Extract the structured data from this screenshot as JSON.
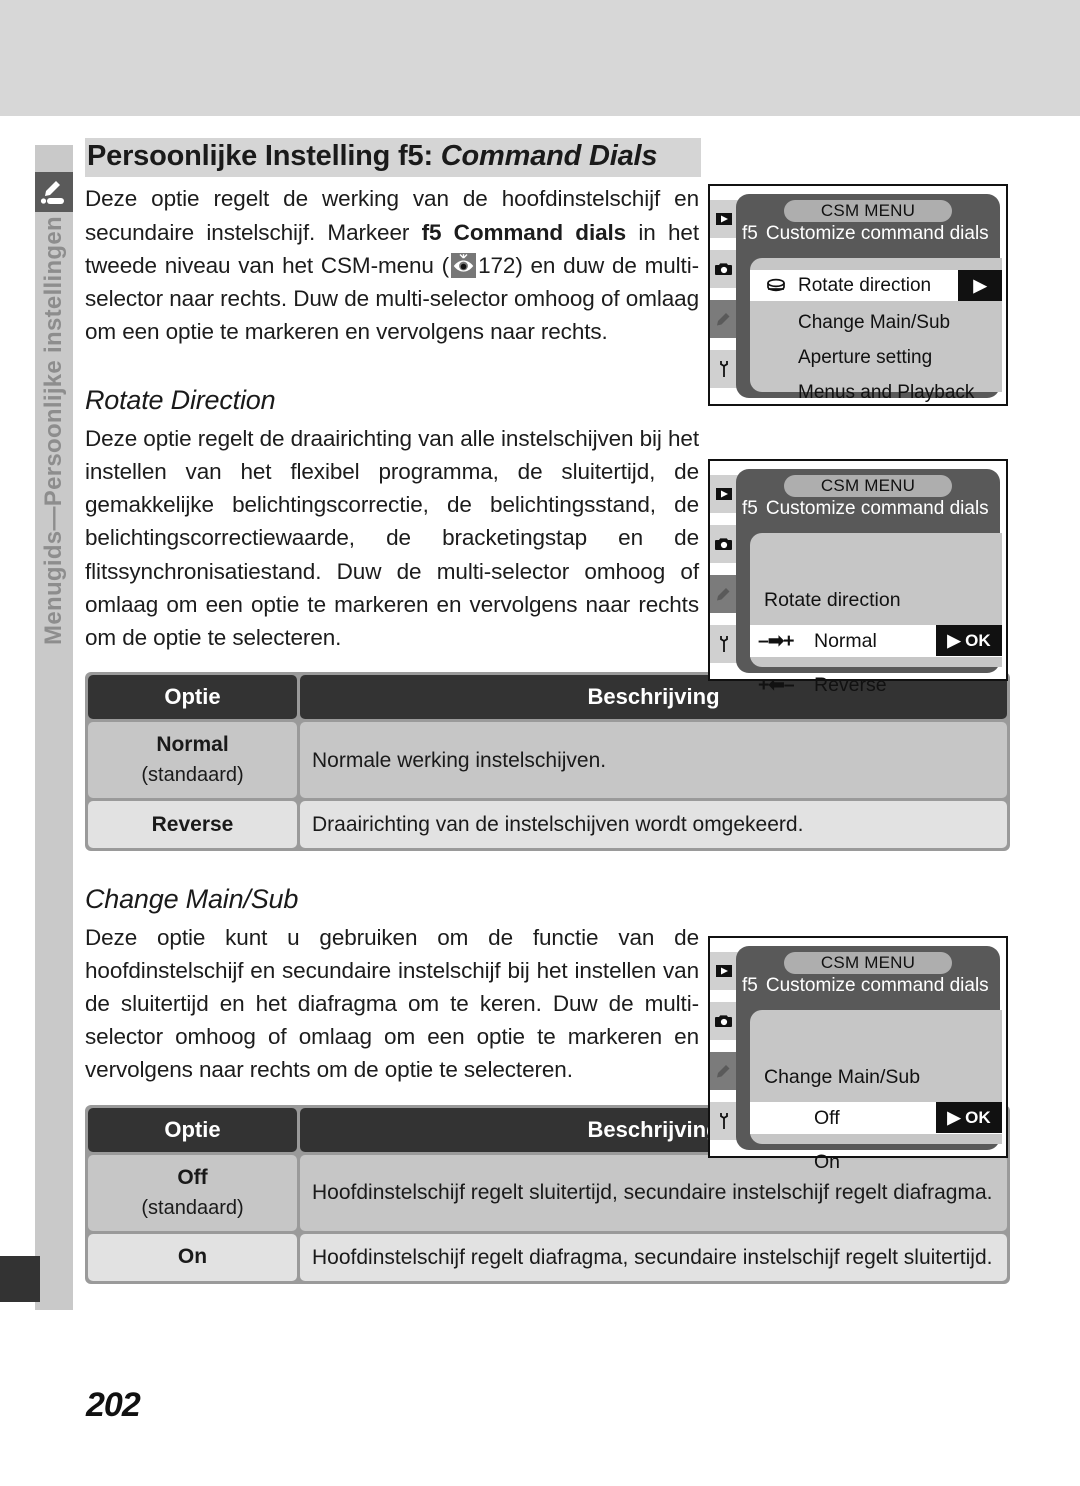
{
  "page": {
    "number": "202",
    "side_label": "Menugids—Persoonlijke instellingen",
    "side_icon": "pencil-bookmark-icon"
  },
  "heading": {
    "title_plain": "Persoonlijke Instelling f5: ",
    "title_italic": "Command Dials"
  },
  "intro": {
    "part1": "Deze optie regelt de werking van de hoofdinstelschijf en secundaire instelschijf. Markeer ",
    "bold": "f5 Command dials",
    "part2": " in het tweede niveau van het CSM-menu (",
    "page_ref": "172",
    "part3": ") en duw de multi-selector naar rechts. Duw de multi-selector omhoog of omlaag om een optie te markeren en vervolgens naar rechts."
  },
  "section_rotate": {
    "title": "Rotate Direction",
    "body": "Deze optie regelt de draairichting van alle instelschijven bij het instellen van het flexibel programma, de sluitertijd, de gemakkelijke belichtingscorrectie, de belichtingsstand, de belichtingscorrectiewaarde, de bracketingstap en de flitssynchronisatiestand. Duw de multi-selector omhoog of omlaag om een optie te markeren en vervolgens naar rechts om de optie te selecteren."
  },
  "section_change": {
    "title": "Change Main/Sub",
    "body": "Deze optie kunt u gebruiken om de functie van de hoofdinstelschijf en secundaire instelschijf bij het instellen van de sluitertijd en het diafragma om te keren. Duw de multi-selector omhoog of omlaag om een optie te markeren en vervolgens naar rechts om de optie te selecteren."
  },
  "table_rotate": {
    "headers": {
      "option": "Optie",
      "description": "Beschrijving"
    },
    "rows": [
      {
        "option": "Normal",
        "default_note": "(standaard)",
        "description": "Normale werking instelschijven."
      },
      {
        "option": "Reverse",
        "default_note": "",
        "description": "Draairichting van de instelschijven wordt omgekeerd."
      }
    ]
  },
  "table_change": {
    "headers": {
      "option": "Optie",
      "description": "Beschrijving"
    },
    "rows": [
      {
        "option": "Off",
        "default_note": "(standaard)",
        "description": "Hoofdinstelschijf regelt sluitertijd, secundaire instelschijf regelt diafragma."
      },
      {
        "option": "On",
        "default_note": "",
        "description": "Hoofdinstelschijf regelt diafragma, secundaire instelschijf regelt sluitertijd."
      }
    ]
  },
  "lcd1": {
    "title": "CSM MENU",
    "code": "f5",
    "subtitle": "Customize command dials",
    "items": [
      {
        "label": "Rotate direction",
        "icon": "command-dial-icon",
        "highlighted": true,
        "arrow": "▶"
      },
      {
        "label": "Change Main/Sub",
        "icon": "",
        "highlighted": false,
        "arrow": ""
      },
      {
        "label": "Aperture setting",
        "icon": "",
        "highlighted": false,
        "arrow": ""
      },
      {
        "label": "Menus and Playback",
        "icon": "",
        "highlighted": false,
        "arrow": ""
      }
    ],
    "tabs": [
      "playback-icon",
      "camera-icon",
      "pencil-icon",
      "wrench-icon"
    ]
  },
  "lcd2": {
    "title": "CSM MENU",
    "code": "f5",
    "subtitle": "Customize command dials",
    "section": "Rotate direction",
    "options": [
      {
        "label": "Normal",
        "symbol": "–➡+",
        "highlighted": true,
        "ok": "▶ OK"
      },
      {
        "label": "Reverse",
        "symbol": "+⬅–",
        "highlighted": false,
        "ok": ""
      }
    ],
    "tabs": [
      "playback-icon",
      "camera-icon",
      "pencil-icon",
      "wrench-icon"
    ]
  },
  "lcd3": {
    "title": "CSM MENU",
    "code": "f5",
    "subtitle": "Customize command dials",
    "section": "Change Main/Sub",
    "options": [
      {
        "label": "Off",
        "symbol": "",
        "highlighted": true,
        "ok": "▶ OK"
      },
      {
        "label": "On",
        "symbol": "",
        "highlighted": false,
        "ok": ""
      }
    ],
    "tabs": [
      "playback-icon",
      "camera-icon",
      "pencil-icon",
      "wrench-icon"
    ]
  },
  "colors": {
    "top_band": "#d7d7d7",
    "side_strip": "#c9c9c9",
    "heading_band": "#d5d5d5",
    "table_header": "#333333",
    "table_row": "#c6c6c6",
    "table_row_alt": "#e2e2e2",
    "lcd_panel": "#595959"
  }
}
